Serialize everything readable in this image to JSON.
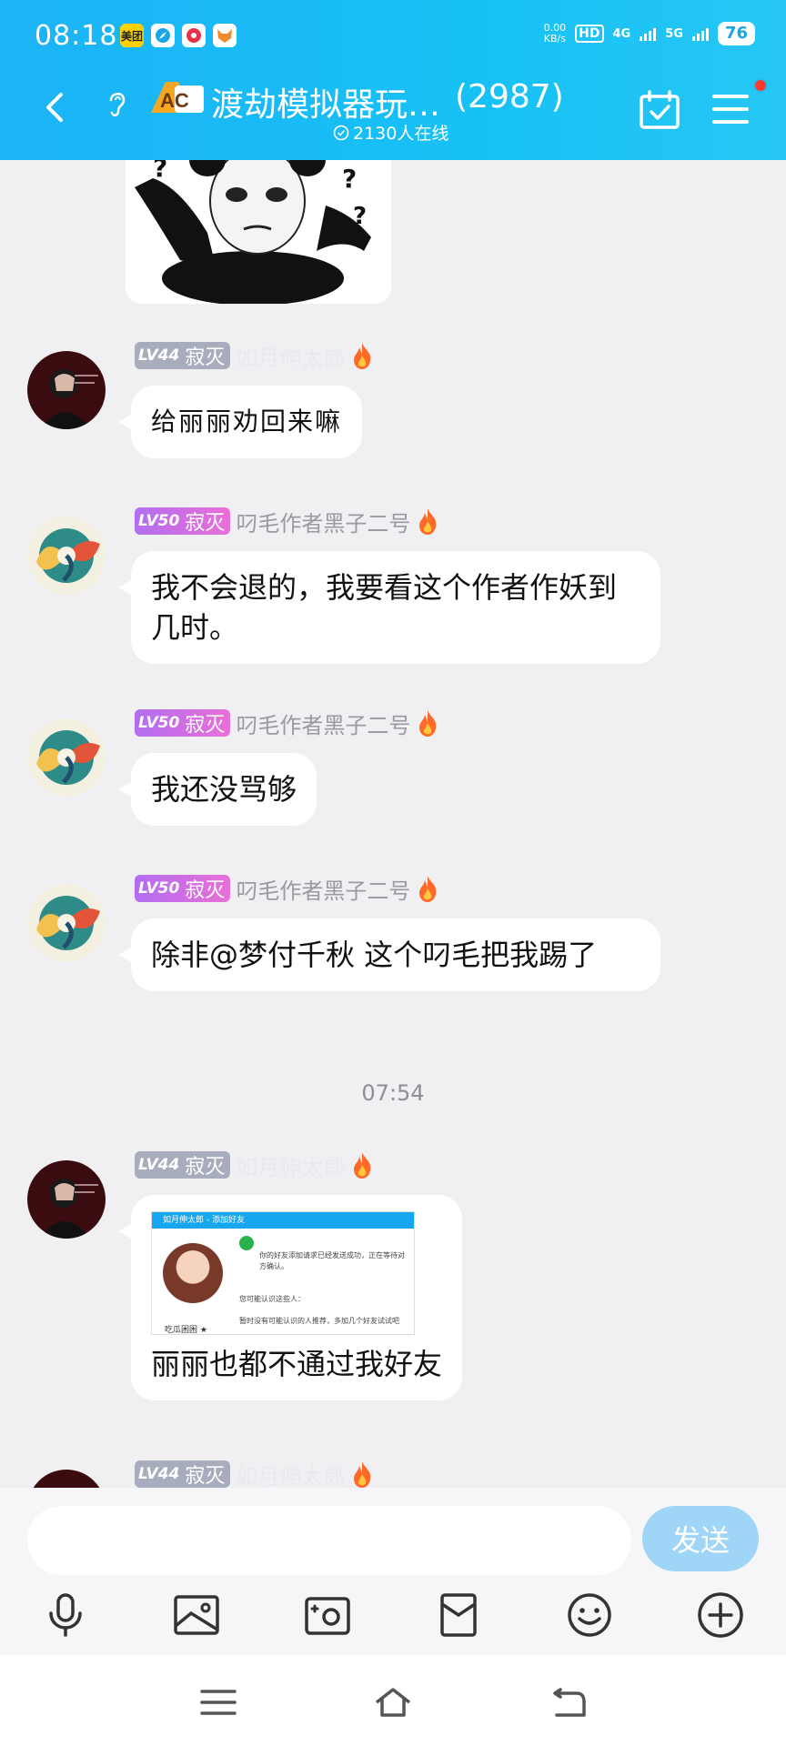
{
  "status_bar": {
    "time": "08:18",
    "app_icons": [
      {
        "name": "meituan-icon",
        "label": "美团",
        "bg": "#ffd100",
        "fg": "#222"
      },
      {
        "name": "compass-icon",
        "label": "",
        "bg": "#ffffff",
        "fg": "#1aa6e5"
      },
      {
        "name": "app-red-icon",
        "label": "",
        "bg": "#ffffff",
        "fg": "#e8324a"
      },
      {
        "name": "app-fox-icon",
        "label": "",
        "bg": "#ffffff",
        "fg": "#f08a2c"
      }
    ],
    "net_speed": "0.00",
    "net_unit": "KB/s",
    "hd": "HD",
    "net_4g": "4G",
    "net_5g": "5G",
    "battery": "76"
  },
  "header": {
    "title": "渡劫模拟器玩…",
    "member_count": "(2987)",
    "online": "2130人在线",
    "logo_text": "AC",
    "accent": "#1cb3f7"
  },
  "messages": [
    {
      "kind": "text",
      "level": "LV44",
      "title": "寂灭",
      "name": "如月伸太郎",
      "text": "给丽丽劝回来嘛",
      "badge": "gray",
      "avatar": "dark",
      "faint": true,
      "script": true
    },
    {
      "kind": "text",
      "level": "LV50",
      "title": "寂灭",
      "name": "叼毛作者黑子二号",
      "text": "我不会退的，我要看这个作者作妖到几时。",
      "badge": "purple",
      "avatar": "swirl"
    },
    {
      "kind": "text",
      "level": "LV50",
      "title": "寂灭",
      "name": "叼毛作者黑子二号",
      "text": "我还没骂够",
      "badge": "purple",
      "avatar": "swirl"
    },
    {
      "kind": "text",
      "level": "LV50",
      "title": "寂灭",
      "name": "叼毛作者黑子二号",
      "text": "除非@梦付千秋 这个叼毛把我踢了",
      "badge": "purple",
      "avatar": "swirl"
    },
    {
      "kind": "image",
      "level": "LV44",
      "title": "寂灭",
      "name": "如月伸太郎",
      "text": "丽丽也都不通过我好友",
      "badge": "gray",
      "avatar": "dark",
      "faint": true,
      "shot": {
        "bar_text": "如月伸太郎 - 添加好友",
        "line1": "你的好友添加请求已经发送成功，正在等待对",
        "line2": "方确认。",
        "line3": "您可能认识这些人：",
        "line4": "暂时没有可能认识的人推荐，多加几个好友试试吧",
        "contact_name": "吃瓜困困 ★"
      }
    },
    {
      "kind": "partial",
      "level": "LV44",
      "title": "寂灭",
      "name": "如月伸太郎",
      "badge": "gray",
      "avatar": "dark",
      "faint": true
    }
  ],
  "timestamp": "07:54",
  "input": {
    "placeholder": "",
    "send_label": "发送"
  },
  "toolbar": [
    "mic-icon",
    "image-icon",
    "camera-icon",
    "red-packet-icon",
    "emoji-icon",
    "plus-icon"
  ],
  "nav": [
    "menu-icon",
    "home-icon",
    "back-icon"
  ]
}
